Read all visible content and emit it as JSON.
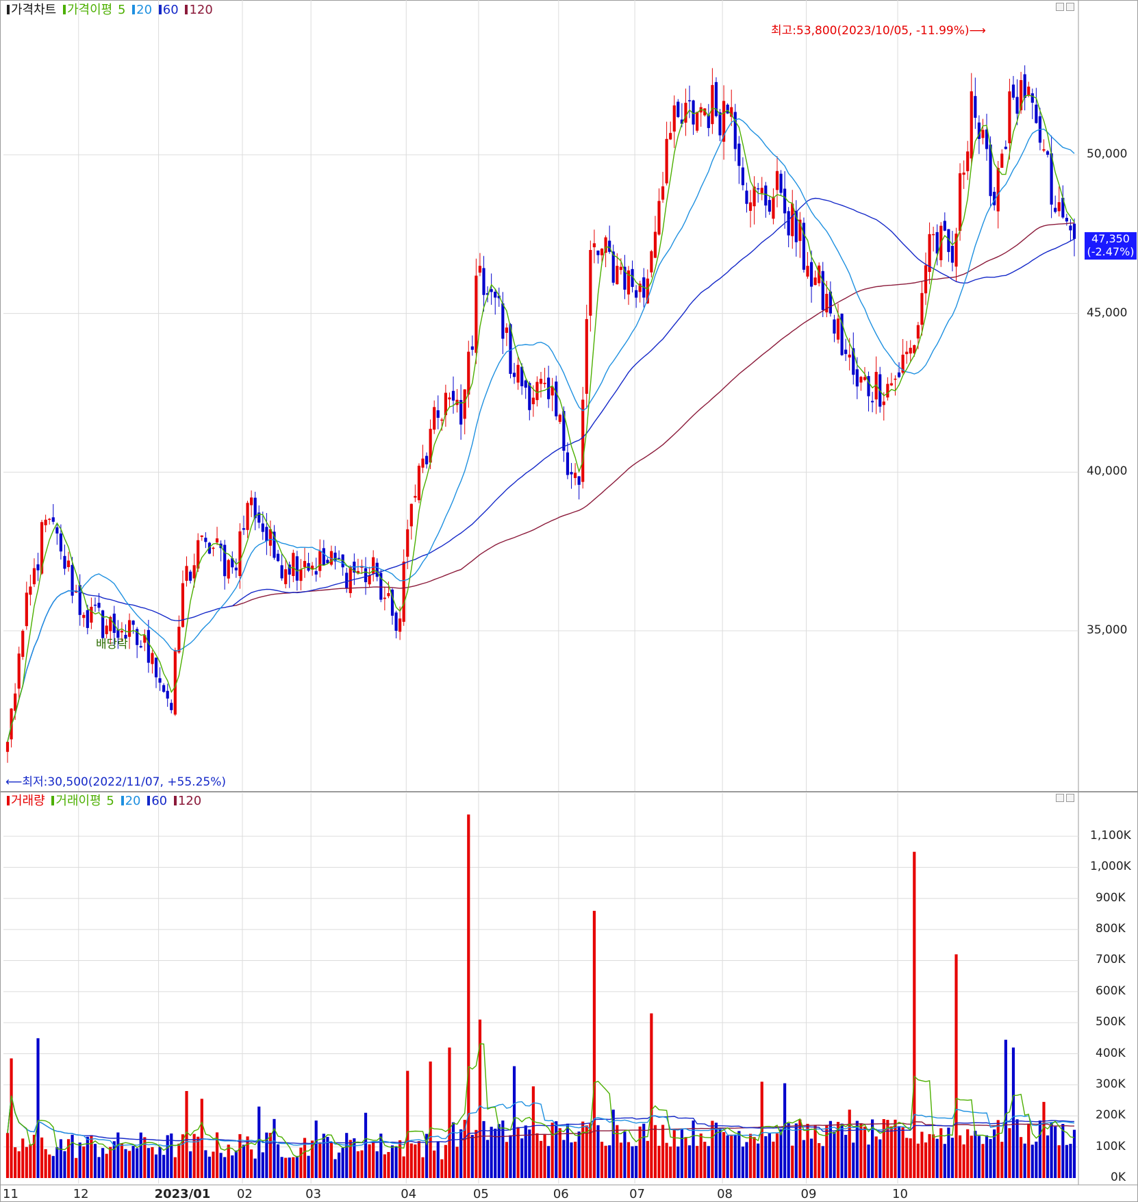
{
  "price_legend": {
    "chart_label": "가격차트",
    "ma_label": "가격이평",
    "periods": [
      "5",
      "20",
      "60",
      "120"
    ]
  },
  "volume_legend": {
    "chart_label": "거래량",
    "ma_label": "거래이평",
    "periods": [
      "5",
      "20",
      "60",
      "120"
    ]
  },
  "colors": {
    "up": "#e60000",
    "down": "#0000cc",
    "ma5": "#4caf00",
    "ma20": "#1e90e0",
    "ma60": "#1428c8",
    "ma120": "#8b1a3a"
  },
  "annotations": {
    "high": "최고:53,800(2023/10/05, -11.99%)",
    "low": "최저:30,500(2022/11/07, +55.25%)",
    "event": "배당락"
  },
  "current_price": {
    "price": "47,350",
    "change": "(-2.47%)"
  },
  "chart_data": [
    {
      "type": "candlestick",
      "ylim": [
        30000,
        54500
      ],
      "y_ticks": [
        35000,
        40000,
        45000,
        50000
      ],
      "y_tick_labels": [
        "35,000",
        "40,000",
        "45,000",
        "50,000"
      ],
      "x_tick_labels": [
        "11",
        "12",
        "2023/01",
        "02",
        "03",
        "04",
        "05",
        "06",
        "07",
        "08",
        "09",
        "10"
      ],
      "grid": true,
      "keypoints": [
        {
          "i": 0,
          "c": 31500
        },
        {
          "i": 4,
          "c": 35000
        },
        {
          "i": 10,
          "c": 38500
        },
        {
          "i": 14,
          "c": 37500
        },
        {
          "i": 20,
          "c": 35500
        },
        {
          "i": 30,
          "c": 35000
        },
        {
          "i": 38,
          "c": 34300
        },
        {
          "i": 43,
          "c": 32500
        },
        {
          "i": 46,
          "c": 36500
        },
        {
          "i": 52,
          "c": 37800
        },
        {
          "i": 59,
          "c": 37000
        },
        {
          "i": 64,
          "c": 39200
        },
        {
          "i": 70,
          "c": 37300
        },
        {
          "i": 78,
          "c": 37200
        },
        {
          "i": 88,
          "c": 37000
        },
        {
          "i": 97,
          "c": 36700
        },
        {
          "i": 102,
          "c": 35000
        },
        {
          "i": 106,
          "c": 39000
        },
        {
          "i": 115,
          "c": 42500
        },
        {
          "i": 119,
          "c": 41500
        },
        {
          "i": 124,
          "c": 46500
        },
        {
          "i": 128,
          "c": 45500
        },
        {
          "i": 133,
          "c": 43000
        },
        {
          "i": 142,
          "c": 42300
        },
        {
          "i": 150,
          "c": 39600
        },
        {
          "i": 153,
          "c": 47000
        },
        {
          "i": 160,
          "c": 46500
        },
        {
          "i": 167,
          "c": 45500
        },
        {
          "i": 173,
          "c": 50500
        },
        {
          "i": 182,
          "c": 51500
        },
        {
          "i": 190,
          "c": 51500
        },
        {
          "i": 195,
          "c": 48500
        },
        {
          "i": 203,
          "c": 48800
        },
        {
          "i": 210,
          "c": 46500
        },
        {
          "i": 216,
          "c": 45000
        },
        {
          "i": 223,
          "c": 42700
        },
        {
          "i": 232,
          "c": 42800
        },
        {
          "i": 238,
          "c": 44000
        },
        {
          "i": 242,
          "c": 47500
        },
        {
          "i": 248,
          "c": 46600
        },
        {
          "i": 253,
          "c": 52000
        },
        {
          "i": 258,
          "c": 48700
        },
        {
          "i": 264,
          "c": 51800
        },
        {
          "i": 270,
          "c": 51000
        },
        {
          "i": 275,
          "c": 48200
        },
        {
          "i": 280,
          "c": 47350
        }
      ]
    },
    {
      "type": "bar",
      "name": "거래량",
      "ylim": [
        0,
        1200000
      ],
      "y_ticks": [
        0,
        100000,
        200000,
        300000,
        400000,
        500000,
        600000,
        700000,
        800000,
        900000,
        1000000,
        1100000
      ],
      "y_tick_labels": [
        "0K",
        "100K",
        "200K",
        "300K",
        "400K",
        "500K",
        "600K",
        "700K",
        "800K",
        "900K",
        "1,000K",
        "1,100K"
      ],
      "spikes": [
        {
          "i": 1,
          "v": 385000
        },
        {
          "i": 8,
          "v": 450000
        },
        {
          "i": 47,
          "v": 280000
        },
        {
          "i": 51,
          "v": 255000
        },
        {
          "i": 66,
          "v": 230000
        },
        {
          "i": 70,
          "v": 190000
        },
        {
          "i": 81,
          "v": 185000
        },
        {
          "i": 94,
          "v": 210000
        },
        {
          "i": 105,
          "v": 345000
        },
        {
          "i": 111,
          "v": 375000
        },
        {
          "i": 116,
          "v": 420000
        },
        {
          "i": 121,
          "v": 1170000
        },
        {
          "i": 124,
          "v": 510000
        },
        {
          "i": 133,
          "v": 360000
        },
        {
          "i": 138,
          "v": 295000
        },
        {
          "i": 154,
          "v": 860000
        },
        {
          "i": 159,
          "v": 220000
        },
        {
          "i": 169,
          "v": 530000
        },
        {
          "i": 198,
          "v": 310000
        },
        {
          "i": 204,
          "v": 305000
        },
        {
          "i": 221,
          "v": 220000
        },
        {
          "i": 238,
          "v": 1050000
        },
        {
          "i": 249,
          "v": 720000
        },
        {
          "i": 262,
          "v": 445000
        },
        {
          "i": 264,
          "v": 420000
        },
        {
          "i": 272,
          "v": 245000
        }
      ]
    }
  ]
}
